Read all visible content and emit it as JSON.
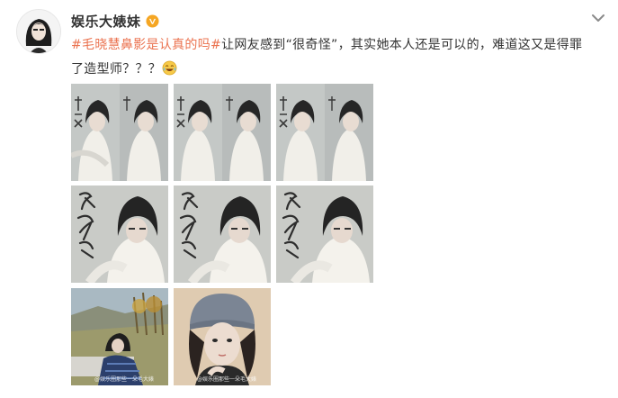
{
  "user": {
    "name": "娱乐大婊妹",
    "verified_icon": "verified-v-icon"
  },
  "post": {
    "topic": "#毛晓慧鼻影是认真的吗#",
    "topic_prefix": "#",
    "topic_name": "毛晓慧",
    "topic_rest": "鼻影是认真的吗#",
    "text": "让网友感到“很奇怪”，其实她本人还是可以的，难道这又是得罪了造型师？？？",
    "emoji": "laugh-cry-emoji"
  },
  "images": {
    "row1": [
      "poster-a",
      "poster-b",
      "poster-c"
    ],
    "row2": [
      "poster-d",
      "poster-e",
      "poster-f"
    ],
    "row3": [
      "photo-outdoor",
      "photo-beanie"
    ],
    "watermark": "@娱乐圈那些一朵毛大婊"
  },
  "colors": {
    "topic": "#eb7350",
    "verified": "#f5a623"
  }
}
